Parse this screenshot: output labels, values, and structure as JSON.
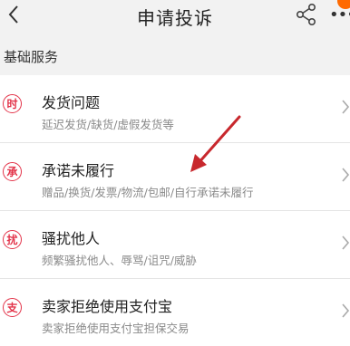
{
  "header": {
    "title": "申请投诉"
  },
  "section_label": "基础服务",
  "items": [
    {
      "icon_text": "时",
      "title": "发货问题",
      "subtitle": "延迟发货/缺货/虚假发货等"
    },
    {
      "icon_text": "承",
      "title": "承诺未履行",
      "subtitle": "赠品/换货/发票/物流/包邮/自行承诺未履行"
    },
    {
      "icon_text": "扰",
      "title": "骚扰他人",
      "subtitle": "频繁骚扰他人、辱骂/诅咒/威胁"
    },
    {
      "icon_text": "支",
      "title": "卖家拒绝使用支付宝",
      "subtitle": "卖家拒绝使用支付宝担保交易"
    }
  ],
  "colors": {
    "accent": "#e3344a",
    "annotation": "#c8282d",
    "notification_badge": "#ff6a00"
  },
  "icons": {
    "back": "chevron-left-icon",
    "share": "share-icon",
    "more": "more-icon",
    "row_arrow": "chevron-right-icon"
  }
}
